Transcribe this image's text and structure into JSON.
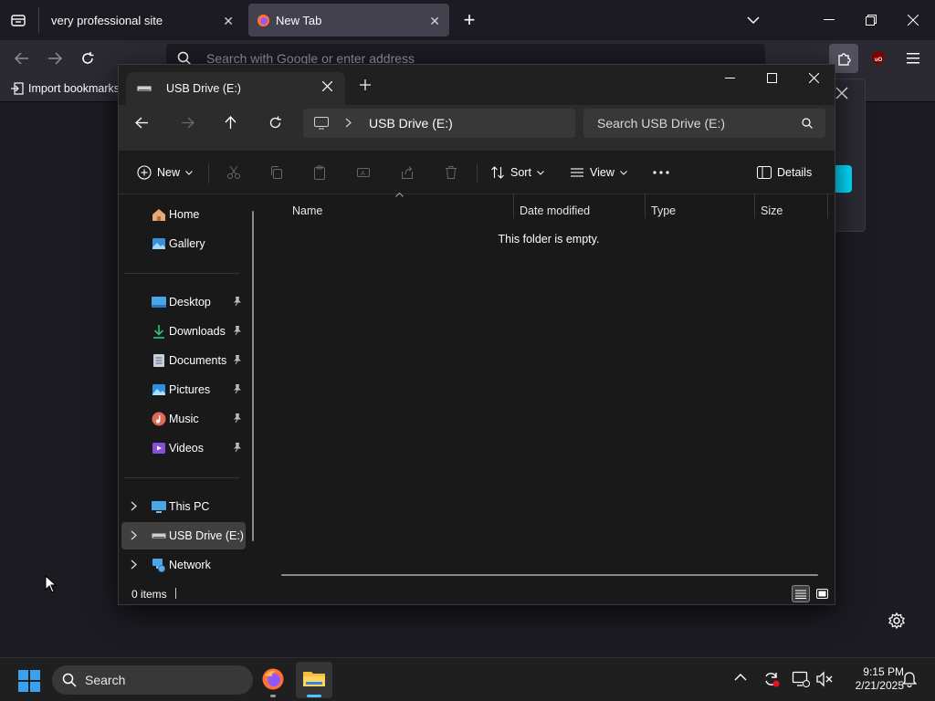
{
  "firefox": {
    "tabs": [
      {
        "title": "very professional site",
        "active": false
      },
      {
        "title": "New Tab",
        "active": true
      }
    ],
    "urlbar_placeholder": "Search with Google or enter address",
    "import_bookmarks": "Import bookmarks"
  },
  "explorer": {
    "tab_title": "USB Drive (E:)",
    "breadcrumb": "USB Drive (E:)",
    "search_placeholder": "Search USB Drive (E:)",
    "commands": {
      "new": "New",
      "sort": "Sort",
      "view": "View",
      "details": "Details"
    },
    "sidebar": {
      "top": [
        {
          "label": "Home",
          "icon": "home-icon"
        },
        {
          "label": "Gallery",
          "icon": "gallery-icon"
        }
      ],
      "quick_access": [
        {
          "label": "Desktop",
          "icon": "desktop-icon"
        },
        {
          "label": "Downloads",
          "icon": "downloads-icon"
        },
        {
          "label": "Documents",
          "icon": "documents-icon"
        },
        {
          "label": "Pictures",
          "icon": "pictures-icon"
        },
        {
          "label": "Music",
          "icon": "music-icon"
        },
        {
          "label": "Videos",
          "icon": "videos-icon"
        }
      ],
      "drives": [
        {
          "label": "This PC",
          "icon": "pc-icon"
        },
        {
          "label": "USB Drive (E:)",
          "icon": "usb-drive-icon",
          "selected": true
        },
        {
          "label": "Network",
          "icon": "network-icon"
        }
      ]
    },
    "columns": [
      "Name",
      "Date modified",
      "Type",
      "Size"
    ],
    "empty_message": "This folder is empty.",
    "status_items": "0 items"
  },
  "taskbar": {
    "search_label": "Search",
    "time": "9:15 PM",
    "date": "2/21/2025"
  },
  "colors": {
    "accent": "#0078d4",
    "firefox_active_tab": "#42414d",
    "selected_sidebar": "#404040"
  }
}
